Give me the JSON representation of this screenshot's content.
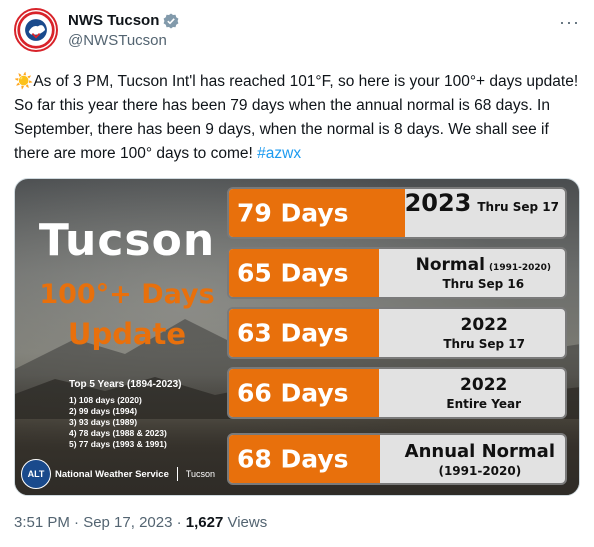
{
  "author": {
    "display_name": "NWS Tucson",
    "handle": "@NWSTucson",
    "avatar_text": "NATIONAL WEATHER SERVICE"
  },
  "more_label": "···",
  "tweet": {
    "emoji": "☀️",
    "text": "As of 3 PM, Tucson Int'l has reached 101°F, so here is your 100°+ days update! So far this year there has been 79 days when the annual normal is 68 days. In September, there has been 9 days, when the normal is 8 days. We shall see if there are more 100° days to come!",
    "hashtag": "#azwx"
  },
  "graphic": {
    "title": "Tucson",
    "subtitle1": "100°+ Days",
    "subtitle2": "Update",
    "top5": {
      "title": "Top 5 Years (1894-2023)",
      "items": [
        "1)   108 days (2020)",
        "2)   99 days (1994)",
        "3)   93 days (1989)",
        "4)   78 days (1988 & 2023)",
        "5)   77 days (1993 & 1991)"
      ]
    },
    "footer": {
      "logo_text": "ALT",
      "org": "National Weather Service",
      "office": "Tucson"
    },
    "panels": [
      {
        "days": "79 Days",
        "value": 79,
        "main": "2023",
        "main_suffix": "Thru Sep 17",
        "sub": ""
      },
      {
        "days": "65 Days",
        "value": 65,
        "main": "Normal",
        "main_suffix": "(1991-2020)",
        "sub": "Thru Sep 16"
      },
      {
        "days": "63 Days",
        "value": 63,
        "main": "2022",
        "main_suffix": "",
        "sub": "Thru Sep 17"
      },
      {
        "days": "66 Days",
        "value": 66,
        "main": "2022",
        "main_suffix": "",
        "sub": "Entire Year"
      },
      {
        "days": "68 Days",
        "value": 68,
        "main": "Annual Normal",
        "main_suffix": "",
        "sub": "(1991-2020)"
      }
    ],
    "colors": {
      "accent": "#e8700c",
      "panel_bg": "#e2e2e2"
    }
  },
  "meta": {
    "time": "3:51 PM · Sep 17, 2023 · ",
    "views_count": "1,627",
    "views_label": " Views"
  }
}
